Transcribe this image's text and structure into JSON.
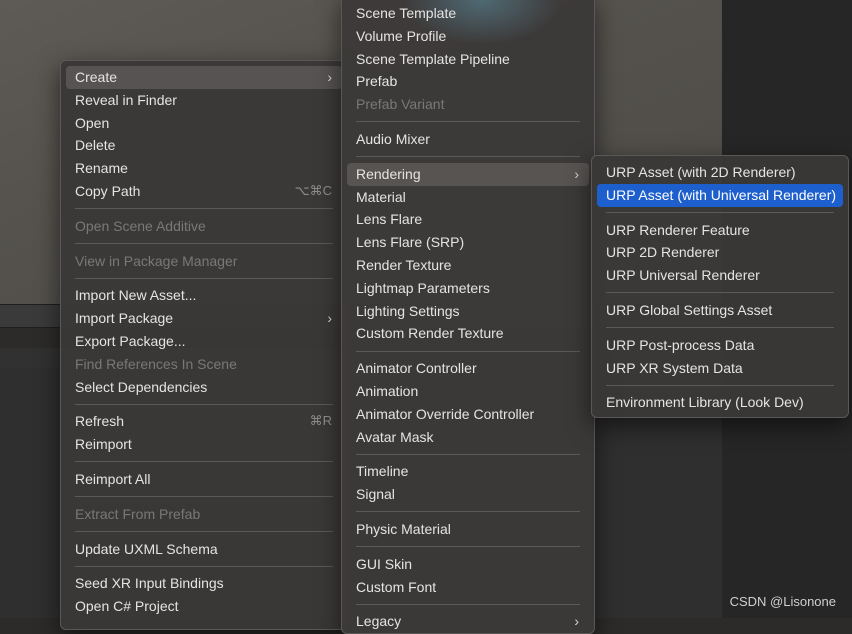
{
  "context_menu": {
    "items": [
      {
        "label": "Create",
        "has_submenu": true,
        "state": "submenu-active"
      },
      {
        "label": "Reveal in Finder"
      },
      {
        "label": "Open"
      },
      {
        "label": "Delete"
      },
      {
        "label": "Rename"
      },
      {
        "label": "Copy Path",
        "shortcut": "⌥⌘C"
      },
      {
        "separator": true
      },
      {
        "label": "Open Scene Additive",
        "disabled": true
      },
      {
        "separator": true
      },
      {
        "label": "View in Package Manager",
        "disabled": true
      },
      {
        "separator": true
      },
      {
        "label": "Import New Asset..."
      },
      {
        "label": "Import Package",
        "has_submenu": true
      },
      {
        "label": "Export Package..."
      },
      {
        "label": "Find References In Scene",
        "disabled": true
      },
      {
        "label": "Select Dependencies"
      },
      {
        "separator": true
      },
      {
        "label": "Refresh",
        "shortcut": "⌘R"
      },
      {
        "label": "Reimport"
      },
      {
        "separator": true
      },
      {
        "label": "Reimport All"
      },
      {
        "separator": true
      },
      {
        "label": "Extract From Prefab",
        "disabled": true
      },
      {
        "separator": true
      },
      {
        "label": "Update UXML Schema"
      },
      {
        "separator": true
      },
      {
        "label": "Seed XR Input Bindings"
      },
      {
        "label": "Open C# Project"
      }
    ]
  },
  "create_menu": {
    "items": [
      {
        "label": "Scene Template"
      },
      {
        "label": "Volume Profile"
      },
      {
        "label": "Scene Template Pipeline"
      },
      {
        "label": "Prefab"
      },
      {
        "label": "Prefab Variant",
        "disabled": true
      },
      {
        "separator": true
      },
      {
        "label": "Audio Mixer"
      },
      {
        "separator": true
      },
      {
        "label": "Rendering",
        "has_submenu": true,
        "state": "submenu-active"
      },
      {
        "label": "Material"
      },
      {
        "label": "Lens Flare"
      },
      {
        "label": "Lens Flare (SRP)"
      },
      {
        "label": "Render Texture"
      },
      {
        "label": "Lightmap Parameters"
      },
      {
        "label": "Lighting Settings"
      },
      {
        "label": "Custom Render Texture"
      },
      {
        "separator": true
      },
      {
        "label": "Animator Controller"
      },
      {
        "label": "Animation"
      },
      {
        "label": "Animator Override Controller"
      },
      {
        "label": "Avatar Mask"
      },
      {
        "separator": true
      },
      {
        "label": "Timeline"
      },
      {
        "label": "Signal"
      },
      {
        "separator": true
      },
      {
        "label": "Physic Material"
      },
      {
        "separator": true
      },
      {
        "label": "GUI Skin"
      },
      {
        "label": "Custom Font"
      },
      {
        "separator": true
      },
      {
        "label": "Legacy",
        "has_submenu": true
      }
    ]
  },
  "rendering_menu": {
    "items": [
      {
        "label": "URP Asset (with 2D Renderer)"
      },
      {
        "label": "URP Asset (with Universal Renderer)",
        "state": "highlighted"
      },
      {
        "separator": true
      },
      {
        "label": "URP Renderer Feature"
      },
      {
        "label": "URP 2D Renderer"
      },
      {
        "label": "URP Universal Renderer"
      },
      {
        "separator": true
      },
      {
        "label": "URP Global Settings Asset"
      },
      {
        "separator": true
      },
      {
        "label": "URP Post-process Data"
      },
      {
        "label": "URP XR System Data"
      },
      {
        "separator": true
      },
      {
        "label": "Environment Library (Look Dev)"
      }
    ]
  },
  "icons": {
    "submenu_arrow": "chevron-right-icon",
    "arrow_glyph": "›"
  },
  "colors": {
    "highlight": "#1d5fcc",
    "menu_bg": "#3a3837",
    "disabled_text": "#7a7877"
  },
  "watermark": "CSDN @Lisonone"
}
